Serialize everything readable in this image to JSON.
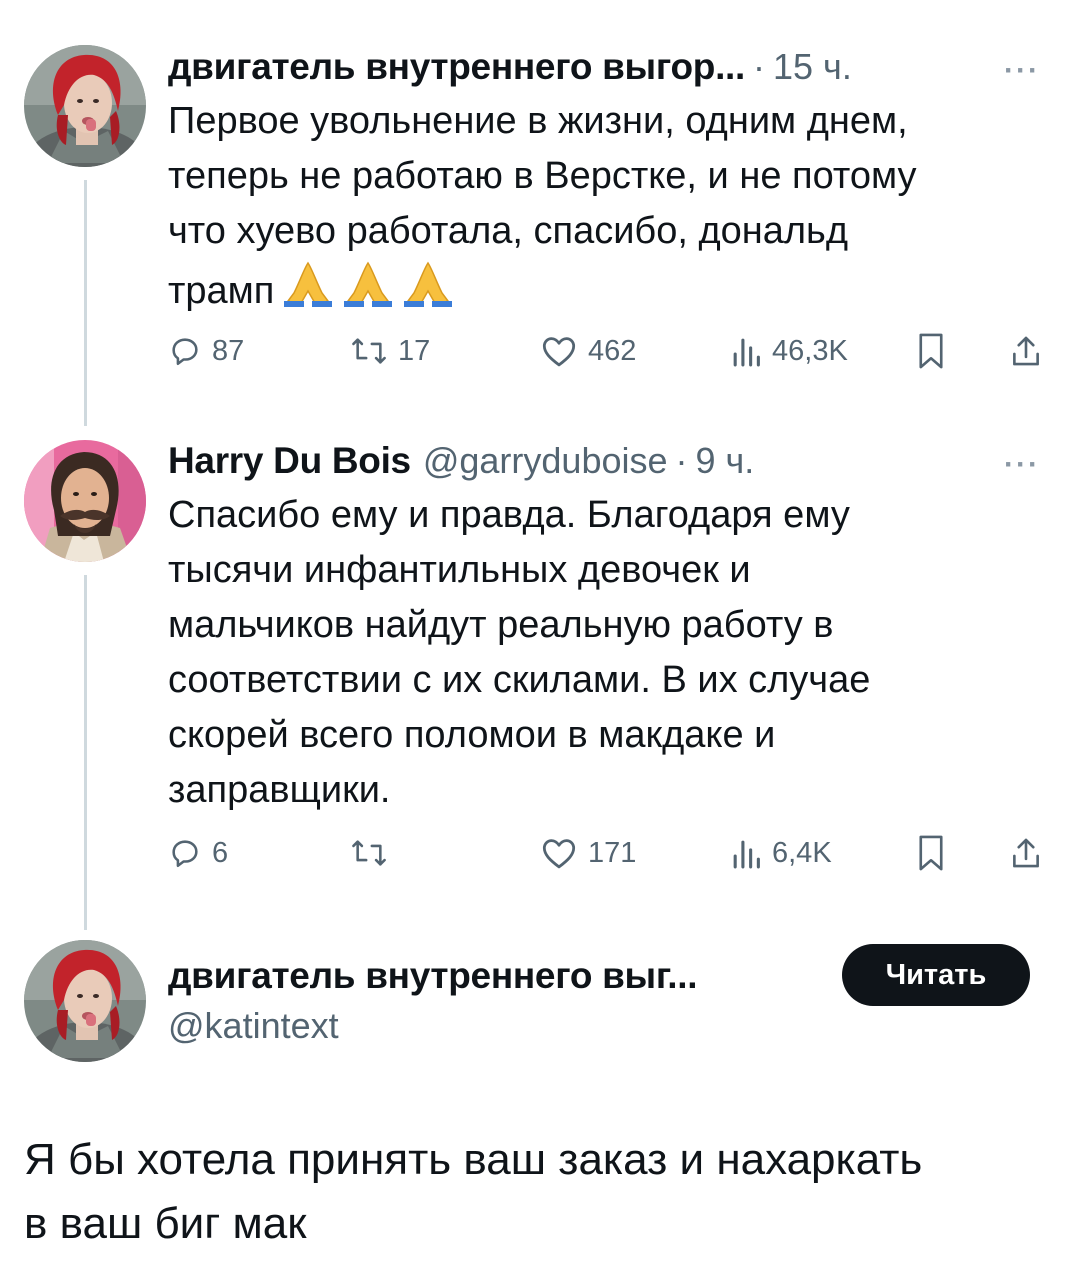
{
  "post1": {
    "name": "двигатель внутреннего выгор...",
    "time": "15 ч.",
    "text_lines": [
      "Первое увольнение в жизни, одним днем,",
      "теперь не работаю в Верстке, и не потому",
      "что хуево работала, спасибо, дональд",
      "трамп"
    ],
    "emoji": "folded-hands-x3",
    "replies": "87",
    "reposts": "17",
    "likes": "462",
    "views": "46,3K"
  },
  "post2": {
    "name": "Harry Du Bois",
    "handle": "@garryduboise",
    "time": "9 ч.",
    "text_lines": [
      "Спасибо ему и правда. Благодаря ему",
      "тысячи инфантильных девочек и",
      "мальчиков найдут реальную работу в",
      "соответствии с их скилами. В их случае",
      "скорей всего поломои в макдаке и",
      "заправщики."
    ],
    "replies": "6",
    "reposts": "",
    "likes": "171",
    "views": "6,4K"
  },
  "post3": {
    "name": "двигатель внутреннего выг...",
    "handle": "@katintext",
    "follow_label": "Читать",
    "text_lines": [
      "Я бы хотела принять ваш заказ и нахаркать",
      "в ваш биг мак"
    ]
  },
  "separator": "·",
  "more": "···",
  "colors": {
    "text": "#0f1419",
    "secondary": "#536471",
    "thread": "#cfd9de",
    "button": "#0f1419"
  }
}
